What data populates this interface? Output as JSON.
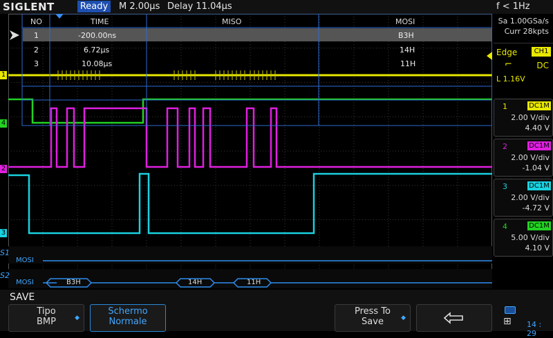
{
  "header": {
    "logo": "SIGLENT",
    "status": "Ready",
    "timebase": "M 2.00µs",
    "delay": "Delay 11.04µs",
    "frequency": "f < 1Hz"
  },
  "acquisition": {
    "sample_rate": "Sa 1.00GSa/s",
    "memory": "Curr 28kpts"
  },
  "trigger": {
    "type": "Edge",
    "source": "CH1",
    "slope_symbol": "⌐",
    "coupling": "DC",
    "level": "L  1.16V"
  },
  "channels": [
    {
      "num": "1",
      "coupling": "DC1M",
      "vdiv": "2.00 V/div",
      "offset": "4.40 V",
      "color": "#e8e800"
    },
    {
      "num": "2",
      "coupling": "DC1M",
      "vdiv": "2.00 V/div",
      "offset": "-1.04 V",
      "color": "#e01fe0"
    },
    {
      "num": "3",
      "coupling": "DC1M",
      "vdiv": "2.00 V/div",
      "offset": "-4.72 V",
      "color": "#19d2e0"
    },
    {
      "num": "4",
      "coupling": "DC1M",
      "vdiv": "5.00 V/div",
      "offset": "4.10 V",
      "color": "#22d322"
    }
  ],
  "decode_table": {
    "headers": [
      "NO",
      "TIME",
      "MISO",
      "MOSI"
    ],
    "rows": [
      {
        "no": "1",
        "time": "-200.00ns",
        "miso": "",
        "mosi": "B3H"
      },
      {
        "no": "2",
        "time": "6.72µs",
        "miso": "",
        "mosi": "14H"
      },
      {
        "no": "3",
        "time": "10.08µs",
        "miso": "",
        "mosi": "11H"
      }
    ]
  },
  "bus_rows": [
    {
      "label_s": "S1",
      "label": "MOSI",
      "packets": []
    },
    {
      "label_s": "S2",
      "label": "MOSI",
      "packets": [
        "B3H",
        "14H",
        "11H"
      ]
    }
  ],
  "channel_markers": [
    "1",
    "4",
    "2",
    "3"
  ],
  "softkeys": {
    "title": "SAVE",
    "tipo": {
      "line1": "Tipo",
      "line2": "BMP"
    },
    "schermo": {
      "line1": "Schermo",
      "line2": "Normale"
    },
    "press": {
      "line1": "Press To",
      "line2": "Save"
    },
    "back_icon": "return-arrow-icon"
  },
  "clock": "14 : 29",
  "colors": {
    "accent": "#41a7ff",
    "ch1": "#e8e800",
    "ch2": "#e01fe0",
    "ch3": "#19d2e0",
    "ch4": "#22d322"
  }
}
